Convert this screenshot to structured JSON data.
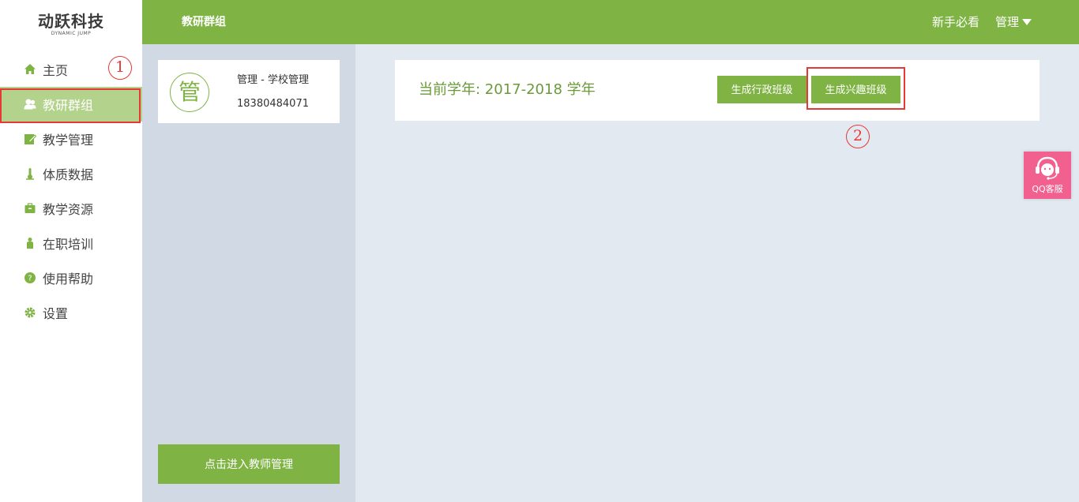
{
  "logo": {
    "main": "动跃科技",
    "sub": "DYNAMIC JUMP"
  },
  "sidebar": {
    "items": [
      {
        "label": "主页",
        "icon": "home-icon"
      },
      {
        "label": "教研群组",
        "icon": "users-icon",
        "active": true
      },
      {
        "label": "教学管理",
        "icon": "edit-icon"
      },
      {
        "label": "体质数据",
        "icon": "thermometer-icon"
      },
      {
        "label": "教学资源",
        "icon": "briefcase-icon"
      },
      {
        "label": "在职培训",
        "icon": "person-icon"
      },
      {
        "label": "使用帮助",
        "icon": "help-icon"
      },
      {
        "label": "设置",
        "icon": "gear-icon"
      }
    ]
  },
  "annotations": {
    "marker1": "1",
    "marker2": "2"
  },
  "topbar": {
    "title": "教研群组",
    "guide": "新手必看",
    "menu": "管理"
  },
  "profile": {
    "avatar": "管",
    "name": "管理 - 学校管理",
    "phone": "18380484071"
  },
  "midcol": {
    "enter_button": "点击进入教师管理"
  },
  "main": {
    "year_label": "当前学年: 2017-2018 学年",
    "btn_admin_class": "生成行政班级",
    "btn_interest_class": "生成兴趣班级"
  },
  "qq": {
    "label": "QQ客服"
  },
  "colors": {
    "primary": "#7fb444",
    "active_nav": "#b3d28c",
    "annotation": "#e53935",
    "qq": "#f1608f"
  }
}
